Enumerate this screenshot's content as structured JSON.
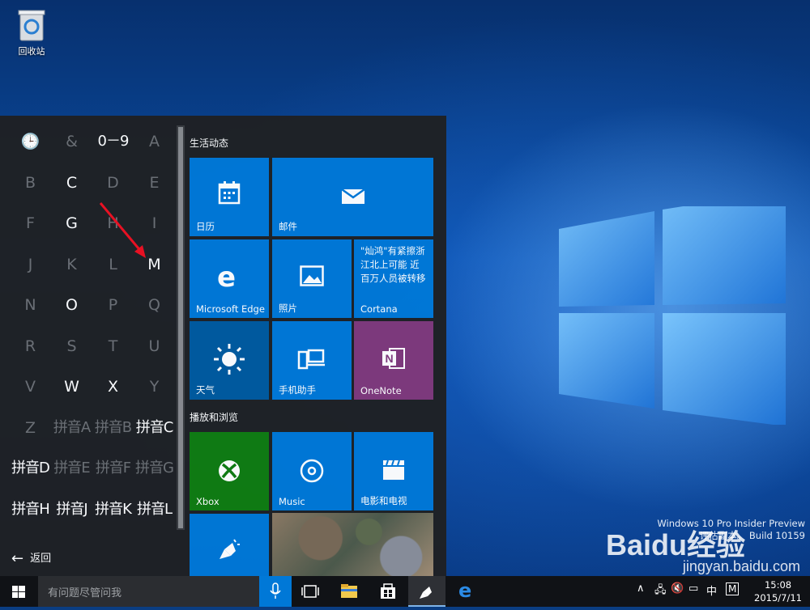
{
  "desktop": {
    "recycle_bin_label": "回收站"
  },
  "start_menu": {
    "letter_grid": [
      {
        "text": "🕒",
        "enabled": false
      },
      {
        "text": "&",
        "enabled": false
      },
      {
        "text": "0－9",
        "enabled": true
      },
      {
        "text": "A",
        "enabled": false
      },
      {
        "text": "B",
        "enabled": false
      },
      {
        "text": "C",
        "enabled": true
      },
      {
        "text": "D",
        "enabled": false
      },
      {
        "text": "E",
        "enabled": false
      },
      {
        "text": "F",
        "enabled": false
      },
      {
        "text": "G",
        "enabled": true
      },
      {
        "text": "H",
        "enabled": false
      },
      {
        "text": "I",
        "enabled": false
      },
      {
        "text": "J",
        "enabled": false
      },
      {
        "text": "K",
        "enabled": false
      },
      {
        "text": "L",
        "enabled": false
      },
      {
        "text": "M",
        "enabled": true
      },
      {
        "text": "N",
        "enabled": false
      },
      {
        "text": "O",
        "enabled": true
      },
      {
        "text": "P",
        "enabled": false
      },
      {
        "text": "Q",
        "enabled": false
      },
      {
        "text": "R",
        "enabled": false
      },
      {
        "text": "S",
        "enabled": false
      },
      {
        "text": "T",
        "enabled": false
      },
      {
        "text": "U",
        "enabled": false
      },
      {
        "text": "V",
        "enabled": false
      },
      {
        "text": "W",
        "enabled": true
      },
      {
        "text": "X",
        "enabled": true
      },
      {
        "text": "Y",
        "enabled": false
      },
      {
        "text": "Z",
        "enabled": false
      },
      {
        "text": "拼音A",
        "enabled": false
      },
      {
        "text": "拼音B",
        "enabled": false
      },
      {
        "text": "拼音C",
        "enabled": true
      },
      {
        "text": "拼音D",
        "enabled": true
      },
      {
        "text": "拼音E",
        "enabled": false
      },
      {
        "text": "拼音F",
        "enabled": false
      },
      {
        "text": "拼音G",
        "enabled": false
      },
      {
        "text": "拼音H",
        "enabled": true
      },
      {
        "text": "拼音J",
        "enabled": true
      },
      {
        "text": "拼音K",
        "enabled": true
      },
      {
        "text": "拼音L",
        "enabled": true
      }
    ],
    "back_label": "返回",
    "groups": {
      "life": "生活动态",
      "play": "播放和浏览"
    },
    "tiles": {
      "calendar": "日历",
      "mail": "邮件",
      "edge": "Microsoft Edge",
      "photos": "照片",
      "cortana": "Cortana",
      "cortana_news": "\"灿鸿\"有紧擦浙江北上可能 近百万人员被转移",
      "weather": "天气",
      "phone": "手机助手",
      "onenote": "OneNote",
      "xbox": "Xbox",
      "music": "Music",
      "movies": "电影和电视"
    }
  },
  "watermark": {
    "edition": "Windows 10 Pro Insider Preview",
    "build": "评估副本。 Build 10159",
    "brand": "Baidu经验",
    "url": "jingyan.baidu.com"
  },
  "taskbar": {
    "search_placeholder": "有问题尽管问我",
    "ime": "中",
    "ime_mode": "M",
    "time": "15:08",
    "date": "2015/7/11"
  },
  "colors": {
    "tile_blue": "#0078d7",
    "xbox_green": "#107c10",
    "onenote_purple": "#80397b",
    "annotation_red": "#e81123"
  }
}
